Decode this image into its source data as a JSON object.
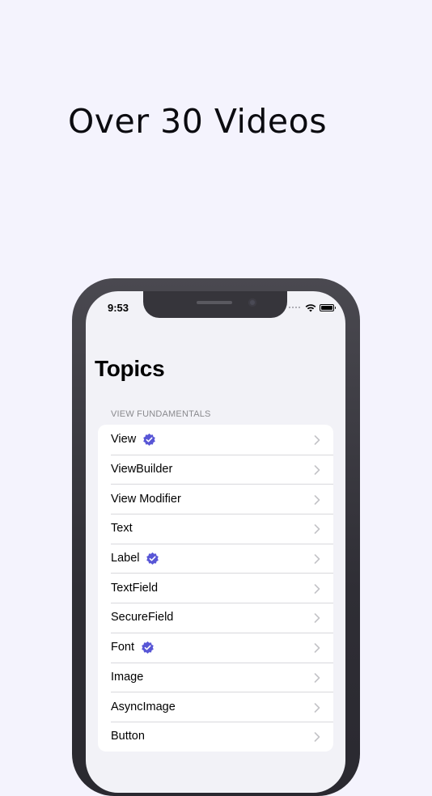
{
  "headline": "Over 30 Videos",
  "status_bar": {
    "time": "9:53"
  },
  "page_title": "Topics",
  "section_header": "VIEW FUNDAMENTALS",
  "accent_color": "#5856d6",
  "items": [
    {
      "label": "View",
      "verified": true
    },
    {
      "label": "ViewBuilder",
      "verified": false
    },
    {
      "label": "View Modifier",
      "verified": false
    },
    {
      "label": "Text",
      "verified": false
    },
    {
      "label": "Label",
      "verified": true
    },
    {
      "label": "TextField",
      "verified": false
    },
    {
      "label": "SecureField",
      "verified": false
    },
    {
      "label": "Font",
      "verified": true
    },
    {
      "label": "Image",
      "verified": false
    },
    {
      "label": "AsyncImage",
      "verified": false
    },
    {
      "label": "Button",
      "verified": false
    }
  ]
}
